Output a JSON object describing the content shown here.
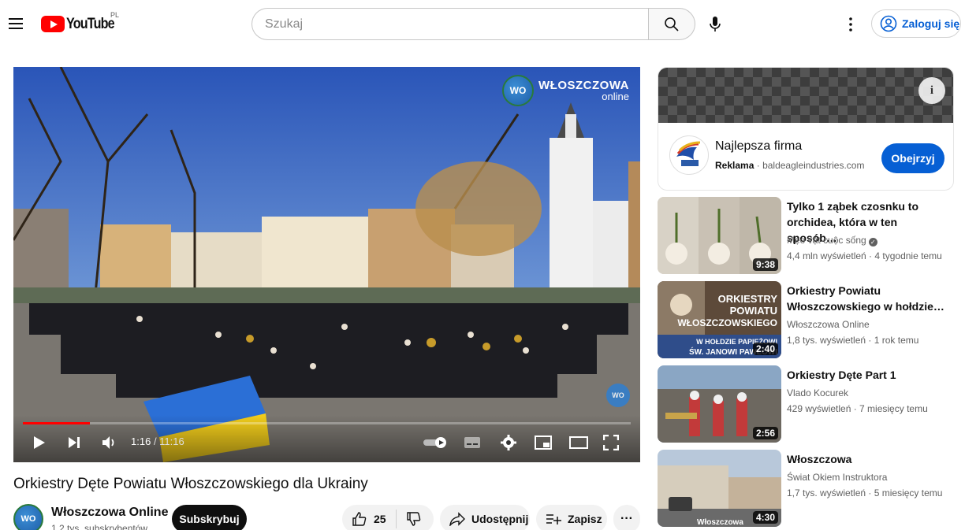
{
  "header": {
    "logo_text": "YouTube",
    "country": "PL",
    "search_placeholder": "Szukaj",
    "signin_label": "Zaloguj się"
  },
  "player": {
    "overlay_brand": "WŁOSZCZOWA",
    "overlay_brand_sub": "online",
    "overlay_badge": "WO",
    "current_time": "1:16",
    "duration": "11:16",
    "progress_fraction": 0.11
  },
  "video": {
    "title": "Orkiestry Dęte Powiatu Włoszczowskiego dla Ukrainy",
    "channel_name": "Włoszczowa Online",
    "channel_subs": "1,2 tys. subskrybentów",
    "channel_avatar_text": "WO",
    "subscribe_label": "Subskrybuj",
    "likes": "25",
    "share_label": "Udostępnij",
    "save_label": "Zapisz",
    "more_label": "···"
  },
  "ad": {
    "title": "Najlepsza firma",
    "label": "Reklama",
    "domain": "baldeagleindustries.com",
    "cta": "Obejrzyj",
    "info_icon": "i"
  },
  "recommendations": [
    {
      "title": "Tylko 1 ząbek czosnku to orchidea, która w ten sposób…",
      "channel": "Mẹo vặt cuộc sống",
      "verified": true,
      "views": "4,4 mln wyświetleń",
      "age": "4 tygodnie temu",
      "duration": "9:38"
    },
    {
      "title": "Orkiestry Powiatu Włoszczowskiego w hołdzie…",
      "channel": "Włoszczowa Online",
      "verified": false,
      "views": "1,8 tys. wyświetleń",
      "age": "1 rok temu",
      "duration": "2:40",
      "thumb_lines": [
        "ORKIESTRY",
        "POWIATU",
        "WŁOSZCZOWSKIEGO",
        "W HOŁDZIE PAPIEŻOWI",
        "ŚW. JANOWI PAWŁOWI"
      ]
    },
    {
      "title": "Orkiestry Dęte Part 1",
      "channel": "Vlado Kocurek",
      "verified": false,
      "views": "429 wyświetleń",
      "age": "7 miesięcy temu",
      "duration": "2:56"
    },
    {
      "title": "Włoszczowa",
      "channel": "Świat Okiem Instruktora",
      "verified": false,
      "views": "1,7 tys. wyświetleń",
      "age": "5 miesięcy temu",
      "duration": "4:30",
      "thumb_caption": "Włoszczowa"
    }
  ],
  "colors": {
    "brand_red": "#ff0000",
    "link_blue": "#065fd4",
    "text_secondary": "#606060"
  }
}
